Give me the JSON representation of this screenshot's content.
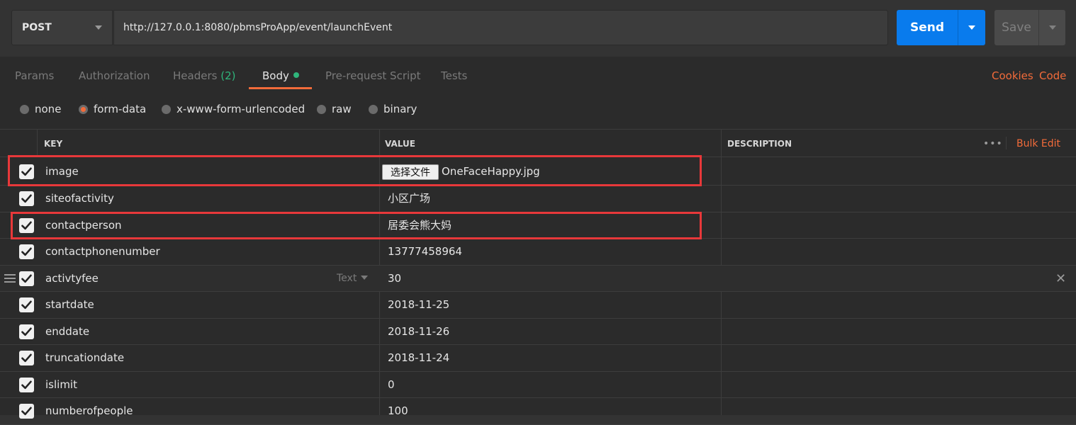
{
  "request": {
    "method": "POST",
    "url": "http://127.0.0.1:8080/pbmsProApp/event/launchEvent",
    "send_label": "Send",
    "save_label": "Save"
  },
  "tabs": [
    {
      "label": "Params"
    },
    {
      "label": "Authorization"
    },
    {
      "label": "Headers",
      "count": "(2)"
    },
    {
      "label": "Body",
      "active": true
    },
    {
      "label": "Pre-request Script"
    },
    {
      "label": "Tests"
    }
  ],
  "links": {
    "cookies": "Cookies",
    "code": "Code"
  },
  "body_types": [
    {
      "label": "none",
      "selected": false
    },
    {
      "label": "form-data",
      "selected": true
    },
    {
      "label": "x-www-form-urlencoded",
      "selected": false
    },
    {
      "label": "raw",
      "selected": false
    },
    {
      "label": "binary",
      "selected": false
    }
  ],
  "table": {
    "headers": {
      "key": "KEY",
      "value": "VALUE",
      "description": "DESCRIPTION"
    },
    "bulk_edit": "Bulk Edit",
    "rows": [
      {
        "key": "image",
        "file_button": "选择文件",
        "value": "OneFaceHappy.jpg",
        "checked": true
      },
      {
        "key": "siteofactivity",
        "value": "小区广场",
        "checked": true
      },
      {
        "key": "contactperson",
        "value": "居委会熊大妈",
        "checked": true
      },
      {
        "key": "contactphonenumber",
        "value": "13777458964",
        "checked": true
      },
      {
        "key": "activtyfee",
        "value": "30",
        "type": "Text",
        "checked": true
      },
      {
        "key": "startdate",
        "value": "2018-11-25",
        "checked": true
      },
      {
        "key": "enddate",
        "value": "2018-11-26",
        "checked": true
      },
      {
        "key": "truncationdate",
        "value": "2018-11-24",
        "checked": true
      },
      {
        "key": "islimit",
        "value": "0",
        "checked": true
      },
      {
        "key": "numberofpeople",
        "value": "100",
        "checked": true
      }
    ]
  },
  "colors": {
    "accent": "#f26b3a",
    "send": "#097bed",
    "highlight": "#e8383a",
    "success": "#2fb57b"
  }
}
